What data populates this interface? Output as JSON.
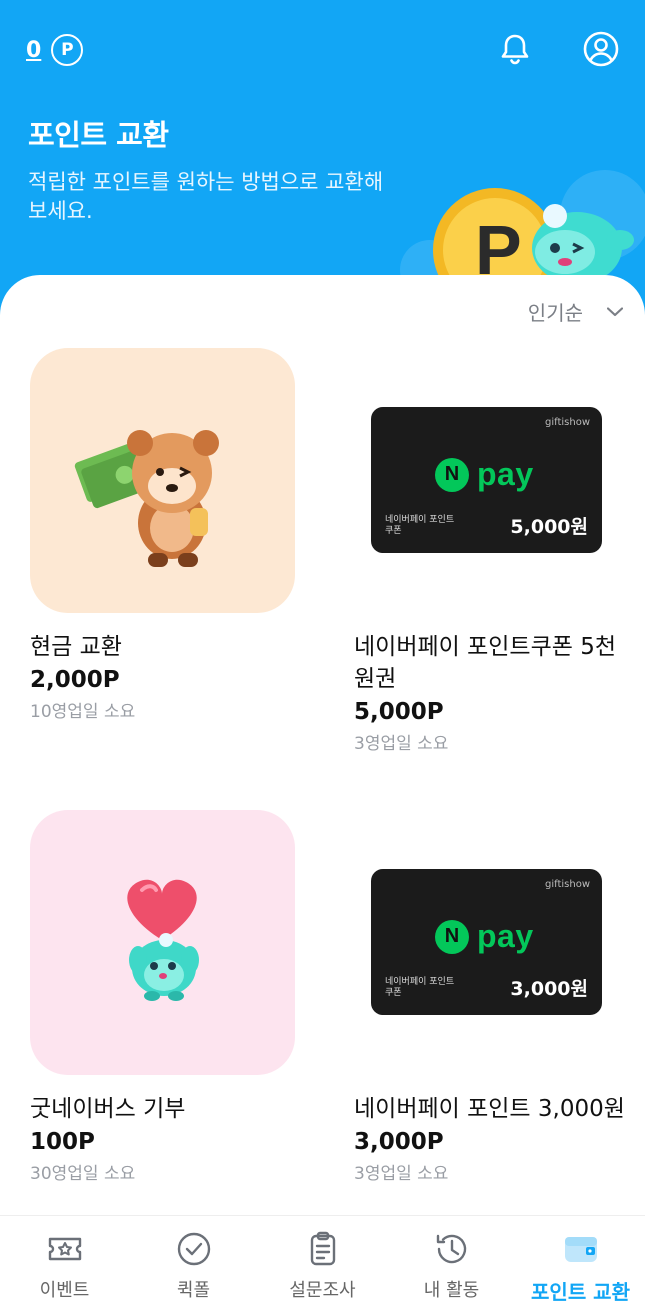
{
  "header": {
    "points_value": "0",
    "points_symbol": "P",
    "title": "포인트 교환",
    "subtitle": "적립한 포인트를 원하는 방법으로 교환해 보세요.",
    "bell_icon": "bell-icon",
    "profile_icon": "profile-icon"
  },
  "sort": {
    "label": "인기순"
  },
  "items": [
    {
      "name": "현금 교환",
      "price": "2,000P",
      "days": "10영업일 소요",
      "thumb": "cash-mascot"
    },
    {
      "name": "네이버페이 포인트쿠폰 5천원권",
      "price": "5,000P",
      "days": "3영업일 소요",
      "thumb": "npay-card",
      "card": {
        "brand": "giftishow",
        "logo_n": "N",
        "logo_text": "pay",
        "sub": "네이버페이 포인트 쿠폰",
        "amount": "5,000원"
      }
    },
    {
      "name": "굿네이버스 기부",
      "price": "100P",
      "days": "30영업일 소요",
      "thumb": "heart-mascot"
    },
    {
      "name": "네이버페이 포인트 3,000원",
      "price": "3,000P",
      "days": "3영업일 소요",
      "thumb": "npay-card",
      "card": {
        "brand": "giftishow",
        "logo_n": "N",
        "logo_text": "pay",
        "sub": "네이버페이 포인트 쿠폰",
        "amount": "3,000원"
      }
    }
  ],
  "nav": [
    {
      "label": "이벤트",
      "icon": "ticket-icon"
    },
    {
      "label": "퀵폴",
      "icon": "check-circle-icon"
    },
    {
      "label": "설문조사",
      "icon": "clipboard-icon"
    },
    {
      "label": "내 활동",
      "icon": "history-icon"
    },
    {
      "label": "포인트 교환",
      "icon": "wallet-icon",
      "active": true
    }
  ],
  "colors": {
    "header_bg": "#12a6f5",
    "npay_green": "#03c75a",
    "active_nav": "#12a6f5"
  }
}
